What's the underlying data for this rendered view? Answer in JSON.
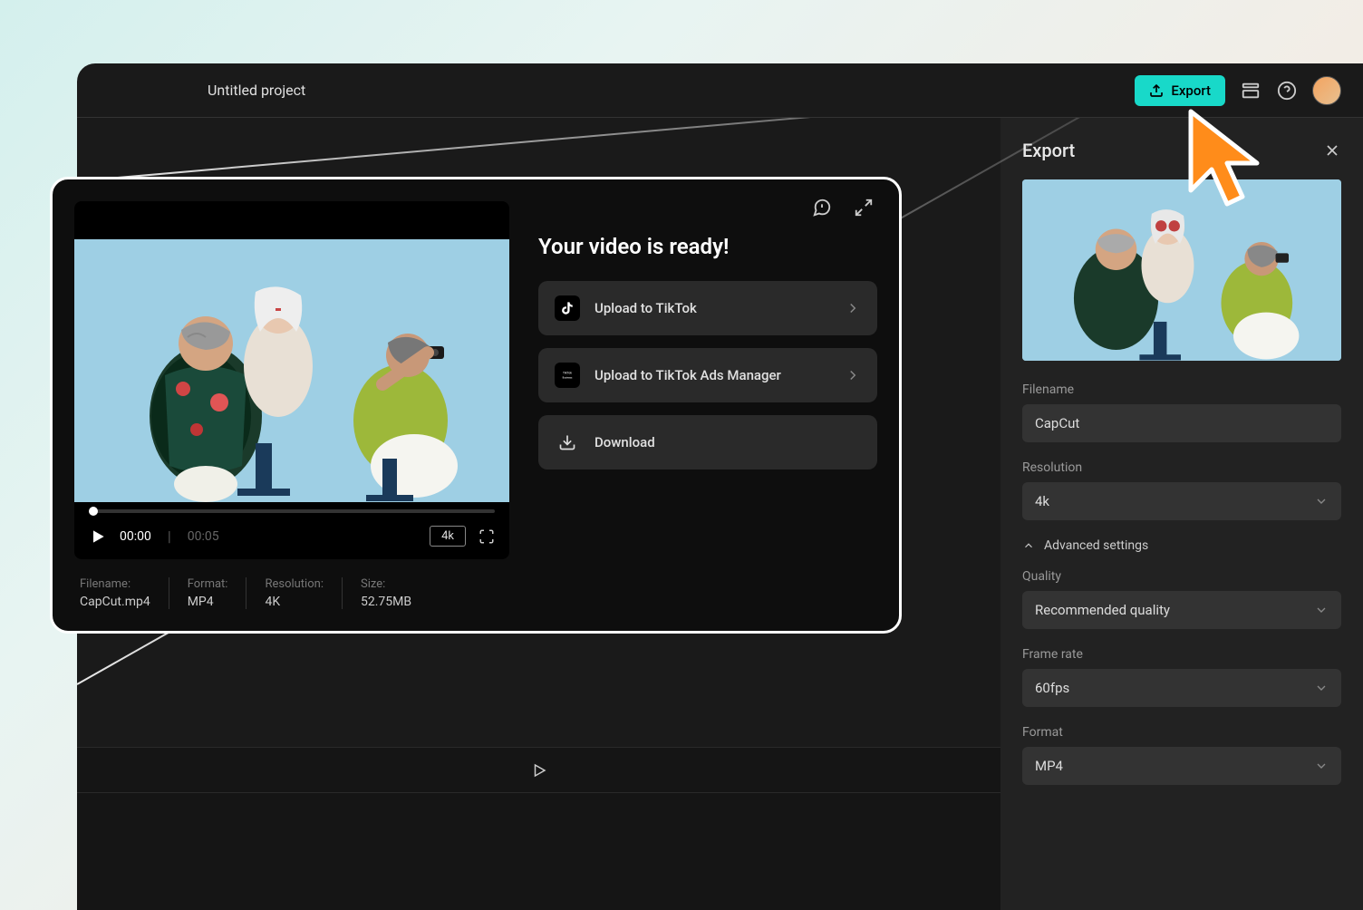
{
  "header": {
    "project_title": "Untitled project",
    "export_label": "Export"
  },
  "export_panel": {
    "title": "Export",
    "filename_label": "Filename",
    "filename_value": "CapCut",
    "resolution_label": "Resolution",
    "resolution_value": "4k",
    "advanced_label": "Advanced settings",
    "quality_label": "Quality",
    "quality_value": "Recommended quality",
    "framerate_label": "Frame rate",
    "framerate_value": "60fps",
    "format_label": "Format",
    "format_value": "MP4"
  },
  "modal": {
    "ready_title": "Your video is ready!",
    "upload_tiktok_label": "Upload to TikTok",
    "upload_ads_label": "Upload to TikTok Ads Manager",
    "download_label": "Download",
    "time_current": "00:00",
    "time_duration": "00:05",
    "quality_badge": "4k",
    "meta": {
      "filename_label": "Filename:",
      "filename_value": "CapCut.mp4",
      "format_label": "Format:",
      "format_value": "MP4",
      "resolution_label": "Resolution:",
      "resolution_value": "4K",
      "size_label": "Size:",
      "size_value": "52.75MB"
    }
  }
}
